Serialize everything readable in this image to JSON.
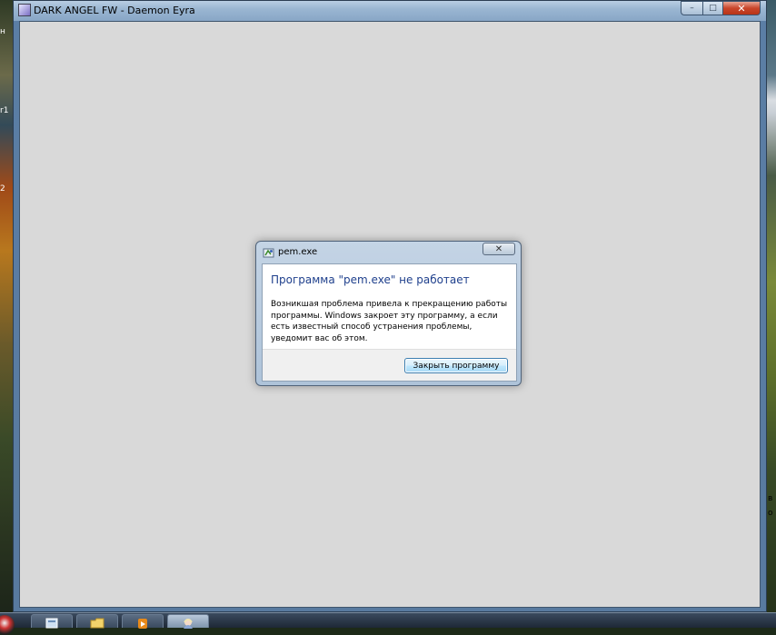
{
  "window": {
    "title": "DARK ANGEL FW - Daemon Eyra",
    "minimize_glyph": "–",
    "maximize_glyph": "□",
    "close_glyph": "✕"
  },
  "background": {
    "left_labels": [
      "н",
      "r1",
      "2"
    ],
    "right_labels": [
      "в",
      "о"
    ]
  },
  "dialog": {
    "title": "pem.exe",
    "close_glyph": "✕",
    "heading": "Программа \"pem.exe\" не работает",
    "message": "Возникшая проблема привела к прекращению работы программы. Windows закроет эту программу, а если есть известный способ устранения проблемы, уведомит вас об этом.",
    "button_label": "Закрыть программу"
  },
  "taskbar": {
    "items": [
      {
        "icon": "start-orb-icon"
      },
      {
        "icon": "desktop-icon"
      },
      {
        "icon": "folder-icon"
      },
      {
        "icon": "media-player-icon"
      },
      {
        "icon": "game-client-icon",
        "active": true
      }
    ]
  },
  "colors": {
    "dialog_heading": "#1e3f8c",
    "client_bg": "#d9d9d9",
    "close_button": "#c9452a"
  }
}
